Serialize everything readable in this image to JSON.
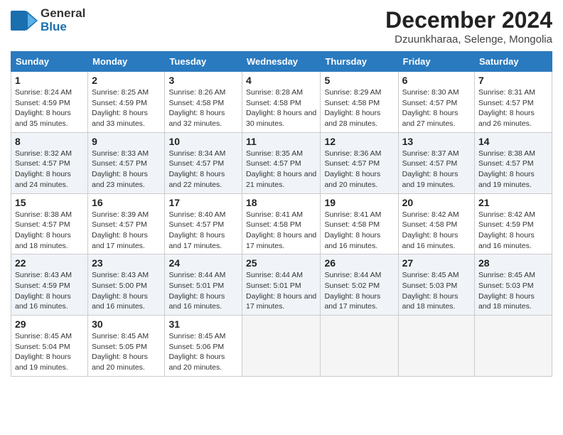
{
  "header": {
    "logo_line1": "General",
    "logo_line2": "Blue",
    "title": "December 2024",
    "subtitle": "Dzuunkharaa, Selenge, Mongolia"
  },
  "days_of_week": [
    "Sunday",
    "Monday",
    "Tuesday",
    "Wednesday",
    "Thursday",
    "Friday",
    "Saturday"
  ],
  "weeks": [
    [
      {
        "day": "1",
        "sunrise": "8:24 AM",
        "sunset": "4:59 PM",
        "daylight": "8 hours and 35 minutes."
      },
      {
        "day": "2",
        "sunrise": "8:25 AM",
        "sunset": "4:59 PM",
        "daylight": "8 hours and 33 minutes."
      },
      {
        "day": "3",
        "sunrise": "8:26 AM",
        "sunset": "4:58 PM",
        "daylight": "8 hours and 32 minutes."
      },
      {
        "day": "4",
        "sunrise": "8:28 AM",
        "sunset": "4:58 PM",
        "daylight": "8 hours and 30 minutes."
      },
      {
        "day": "5",
        "sunrise": "8:29 AM",
        "sunset": "4:58 PM",
        "daylight": "8 hours and 28 minutes."
      },
      {
        "day": "6",
        "sunrise": "8:30 AM",
        "sunset": "4:57 PM",
        "daylight": "8 hours and 27 minutes."
      },
      {
        "day": "7",
        "sunrise": "8:31 AM",
        "sunset": "4:57 PM",
        "daylight": "8 hours and 26 minutes."
      }
    ],
    [
      {
        "day": "8",
        "sunrise": "8:32 AM",
        "sunset": "4:57 PM",
        "daylight": "8 hours and 24 minutes."
      },
      {
        "day": "9",
        "sunrise": "8:33 AM",
        "sunset": "4:57 PM",
        "daylight": "8 hours and 23 minutes."
      },
      {
        "day": "10",
        "sunrise": "8:34 AM",
        "sunset": "4:57 PM",
        "daylight": "8 hours and 22 minutes."
      },
      {
        "day": "11",
        "sunrise": "8:35 AM",
        "sunset": "4:57 PM",
        "daylight": "8 hours and 21 minutes."
      },
      {
        "day": "12",
        "sunrise": "8:36 AM",
        "sunset": "4:57 PM",
        "daylight": "8 hours and 20 minutes."
      },
      {
        "day": "13",
        "sunrise": "8:37 AM",
        "sunset": "4:57 PM",
        "daylight": "8 hours and 19 minutes."
      },
      {
        "day": "14",
        "sunrise": "8:38 AM",
        "sunset": "4:57 PM",
        "daylight": "8 hours and 19 minutes."
      }
    ],
    [
      {
        "day": "15",
        "sunrise": "8:38 AM",
        "sunset": "4:57 PM",
        "daylight": "8 hours and 18 minutes."
      },
      {
        "day": "16",
        "sunrise": "8:39 AM",
        "sunset": "4:57 PM",
        "daylight": "8 hours and 17 minutes."
      },
      {
        "day": "17",
        "sunrise": "8:40 AM",
        "sunset": "4:57 PM",
        "daylight": "8 hours and 17 minutes."
      },
      {
        "day": "18",
        "sunrise": "8:41 AM",
        "sunset": "4:58 PM",
        "daylight": "8 hours and 17 minutes."
      },
      {
        "day": "19",
        "sunrise": "8:41 AM",
        "sunset": "4:58 PM",
        "daylight": "8 hours and 16 minutes."
      },
      {
        "day": "20",
        "sunrise": "8:42 AM",
        "sunset": "4:58 PM",
        "daylight": "8 hours and 16 minutes."
      },
      {
        "day": "21",
        "sunrise": "8:42 AM",
        "sunset": "4:59 PM",
        "daylight": "8 hours and 16 minutes."
      }
    ],
    [
      {
        "day": "22",
        "sunrise": "8:43 AM",
        "sunset": "4:59 PM",
        "daylight": "8 hours and 16 minutes."
      },
      {
        "day": "23",
        "sunrise": "8:43 AM",
        "sunset": "5:00 PM",
        "daylight": "8 hours and 16 minutes."
      },
      {
        "day": "24",
        "sunrise": "8:44 AM",
        "sunset": "5:01 PM",
        "daylight": "8 hours and 16 minutes."
      },
      {
        "day": "25",
        "sunrise": "8:44 AM",
        "sunset": "5:01 PM",
        "daylight": "8 hours and 17 minutes."
      },
      {
        "day": "26",
        "sunrise": "8:44 AM",
        "sunset": "5:02 PM",
        "daylight": "8 hours and 17 minutes."
      },
      {
        "day": "27",
        "sunrise": "8:45 AM",
        "sunset": "5:03 PM",
        "daylight": "8 hours and 18 minutes."
      },
      {
        "day": "28",
        "sunrise": "8:45 AM",
        "sunset": "5:03 PM",
        "daylight": "8 hours and 18 minutes."
      }
    ],
    [
      {
        "day": "29",
        "sunrise": "8:45 AM",
        "sunset": "5:04 PM",
        "daylight": "8 hours and 19 minutes."
      },
      {
        "day": "30",
        "sunrise": "8:45 AM",
        "sunset": "5:05 PM",
        "daylight": "8 hours and 20 minutes."
      },
      {
        "day": "31",
        "sunrise": "8:45 AM",
        "sunset": "5:06 PM",
        "daylight": "8 hours and 20 minutes."
      },
      null,
      null,
      null,
      null
    ]
  ]
}
